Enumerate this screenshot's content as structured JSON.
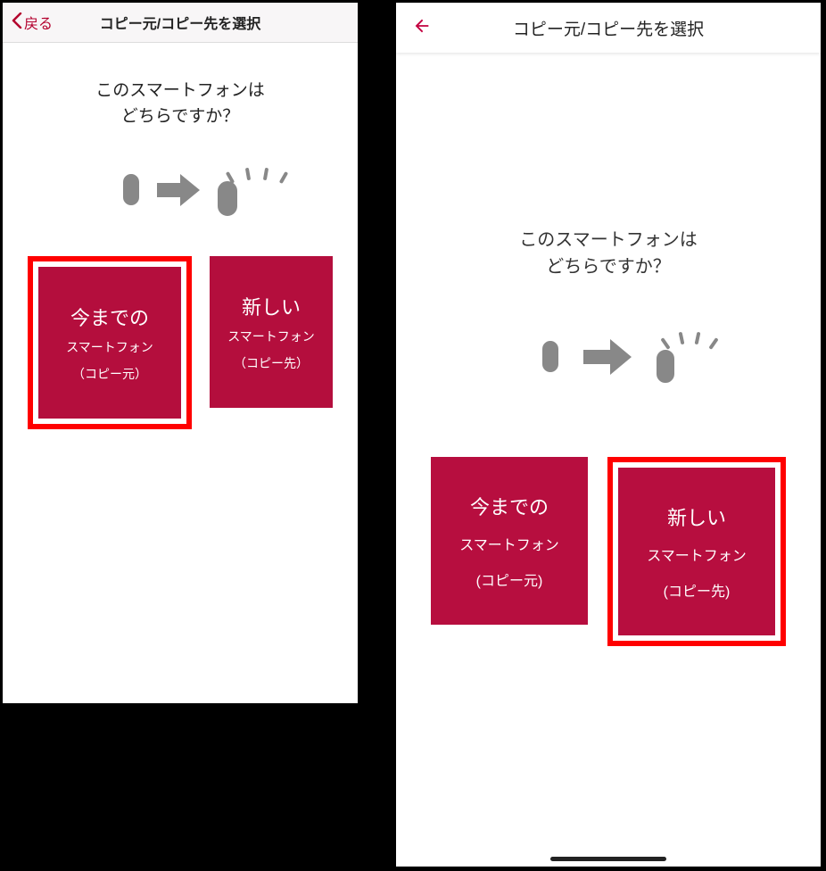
{
  "colors": {
    "brand": "#b40e3d",
    "accent": "#ff0000",
    "icon_gray": "#888888"
  },
  "screenA": {
    "header": {
      "back_label": "戻る",
      "title": "コピー元/コピー先を選択"
    },
    "question_line1": "このスマートフォンは",
    "question_line2": "どちらですか？",
    "selected": "source",
    "options": {
      "source": {
        "line1": "今までの",
        "line2": "スマートフォン",
        "line3": "（コピー元）"
      },
      "destination": {
        "line1": "新しい",
        "line2": "スマートフォン",
        "line3": "（コピー先）"
      }
    },
    "illustration": {
      "left_icon": "phone-icon",
      "arrow_icon": "arrow-right-icon",
      "right_icon": "phone-active-icon"
    }
  },
  "screenB": {
    "header": {
      "title": "コピー元/コピー先を選択"
    },
    "question_line1": "このスマートフォンは",
    "question_line2": "どちらですか？",
    "selected": "destination",
    "options": {
      "source": {
        "line1": "今までの",
        "line2": "スマートフォン",
        "line3": "(コピー元)"
      },
      "destination": {
        "line1": "新しい",
        "line2": "スマートフォン",
        "line3": "(コピー先)"
      }
    },
    "illustration": {
      "left_icon": "phone-icon",
      "arrow_icon": "arrow-right-icon",
      "right_icon": "phone-active-icon"
    }
  }
}
